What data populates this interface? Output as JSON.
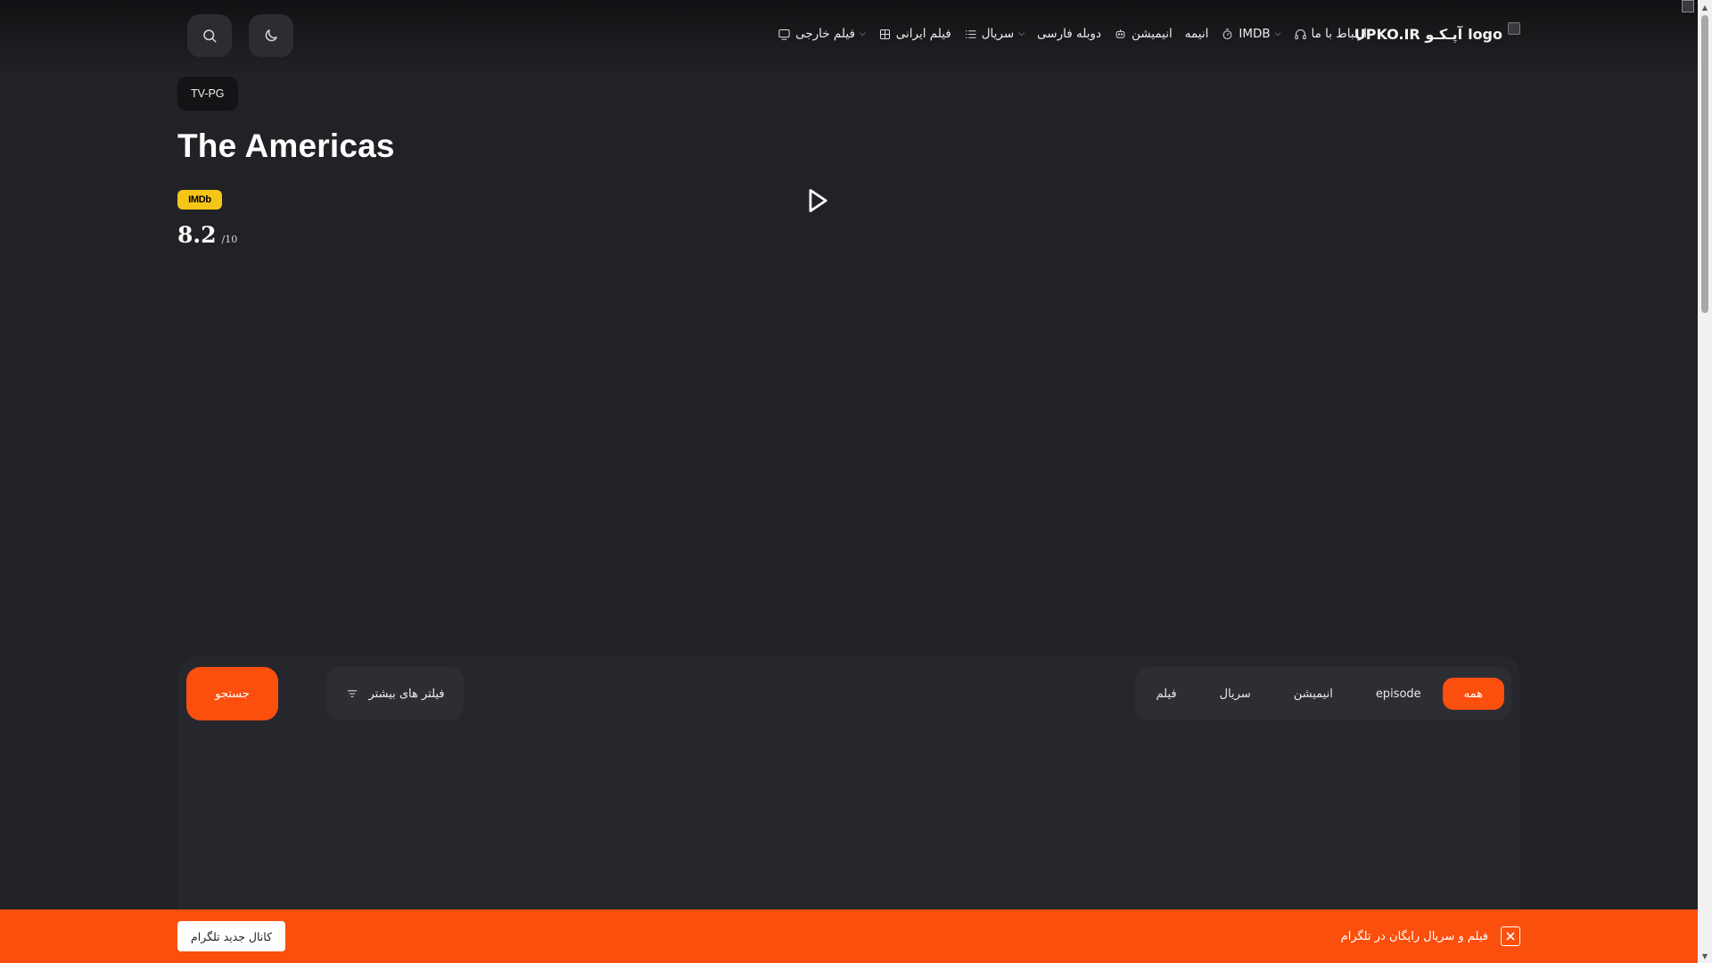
{
  "header": {
    "logo_text": "UPKO.IR آپـکـو",
    "logo_alt": "logo",
    "nav": [
      {
        "label": "فیلم خارجی",
        "icon": "monitor-icon",
        "dropdown": true
      },
      {
        "label": "فیلم ایرانی",
        "icon": "grid-icon",
        "dropdown": false
      },
      {
        "label": "سریال",
        "icon": "list-icon",
        "dropdown": true
      },
      {
        "label": "دوبله فارسی",
        "icon": "",
        "dropdown": false
      },
      {
        "label": "انیمیشن",
        "icon": "robot-icon",
        "dropdown": false
      },
      {
        "label": "انیمه",
        "icon": "",
        "dropdown": false
      },
      {
        "label": "IMDB",
        "icon": "timer-icon",
        "dropdown": true
      },
      {
        "label": "ارتباط با ما",
        "icon": "headset-icon",
        "dropdown": false
      }
    ]
  },
  "hero": {
    "rating": "TV-PG",
    "title": "The Americas",
    "imdb_badge": "IMDb",
    "score": "8.2",
    "score_max": "/10"
  },
  "filters": {
    "search_label": "جستجو",
    "more_filters_label": "فیلتر های بیشتر",
    "tabs": [
      "همه",
      "episode",
      "انیمیشن",
      "سریال",
      "فیلم"
    ],
    "active_tab": "همه"
  },
  "promo": {
    "text": "فیلم و سریال رایگان در تلگرام",
    "button_label": "کانال جدید تلگرام"
  },
  "colors": {
    "accent": "#fb4f0e",
    "background": "#222226",
    "panel": "#26272d",
    "imdb": "#f5c518"
  }
}
